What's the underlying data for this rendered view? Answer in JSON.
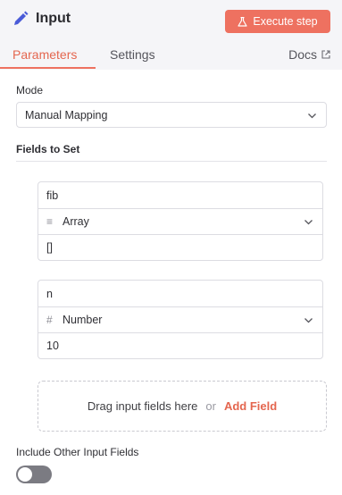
{
  "header": {
    "title": "Input",
    "execute_label": "Execute step",
    "tabs": [
      {
        "label": "Parameters",
        "active": true
      },
      {
        "label": "Settings",
        "active": false
      }
    ],
    "docs_label": "Docs",
    "accent_color": "#ee7160"
  },
  "mode": {
    "label": "Mode",
    "value": "Manual Mapping"
  },
  "fields_to_set": {
    "label": "Fields to Set",
    "fields": [
      {
        "name": "fib",
        "type": "Array",
        "type_icon": "list-icon",
        "value": "[]"
      },
      {
        "name": "n",
        "type": "Number",
        "type_icon": "hash-icon",
        "value": "10"
      }
    ]
  },
  "drop_zone": {
    "text": "Drag input fields here",
    "or": "or",
    "add_label": "Add Field"
  },
  "include_other": {
    "label": "Include Other Input Fields",
    "enabled": false
  }
}
